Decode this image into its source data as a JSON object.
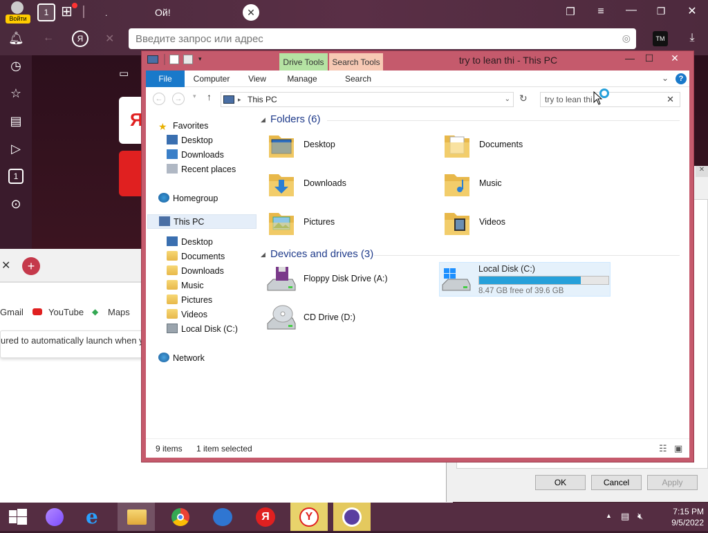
{
  "browser": {
    "login_label": "Войти",
    "tab_title": "Ой!",
    "tab_count": "1",
    "address_placeholder": "Введите запрос или адрес",
    "sidebar_tab_count": "1",
    "newtab_partial_text": "Я",
    "bookmarks": [
      {
        "label": "Gmail",
        "icon": "gmail-icon"
      },
      {
        "label": "YouTube",
        "icon": "youtube-icon"
      },
      {
        "label": "Maps",
        "icon": "maps-icon"
      }
    ],
    "launch_message": "ured to automatically launch when y"
  },
  "dialog_behind": {
    "ok_label": "OK",
    "cancel_label": "Cancel",
    "apply_label": "Apply"
  },
  "explorer": {
    "title": "try to lean thi - This PC",
    "context_tabs": {
      "drive_tools": "Drive Tools",
      "search_tools": "Search Tools"
    },
    "ribbon_tabs": [
      "File",
      "Computer",
      "View",
      "Manage",
      "Search"
    ],
    "path": "This PC",
    "search_value": "try to lean thi",
    "nav": {
      "favorites": "Favorites",
      "favorites_items": [
        "Desktop",
        "Downloads",
        "Recent places"
      ],
      "homegroup": "Homegroup",
      "this_pc": "This PC",
      "this_pc_items": [
        "Desktop",
        "Documents",
        "Downloads",
        "Music",
        "Pictures",
        "Videos",
        "Local Disk (C:)"
      ],
      "network": "Network"
    },
    "folders_header": "Folders (6)",
    "folders": [
      "Desktop",
      "Documents",
      "Downloads",
      "Music",
      "Pictures",
      "Videos"
    ],
    "devices_header": "Devices and drives (3)",
    "devices": {
      "floppy": "Floppy Disk Drive (A:)",
      "cd": "CD Drive (D:)",
      "local_disk": "Local Disk (C:)",
      "local_disk_free": "8.47 GB free of 39.6 GB",
      "local_disk_used_fraction": 0.786
    },
    "status": {
      "items": "9 items",
      "selected": "1 item selected"
    }
  },
  "taskbar": {
    "time": "7:15 PM",
    "date": "9/5/2022"
  },
  "colors": {
    "explorer_border": "#c55a6c",
    "drive_tools_tab": "#b5e3a3",
    "search_tools_tab": "#f7c9b4",
    "file_tab": "#1979ca",
    "disk_bar": "#26a0da",
    "taskbar": "#552d42"
  }
}
